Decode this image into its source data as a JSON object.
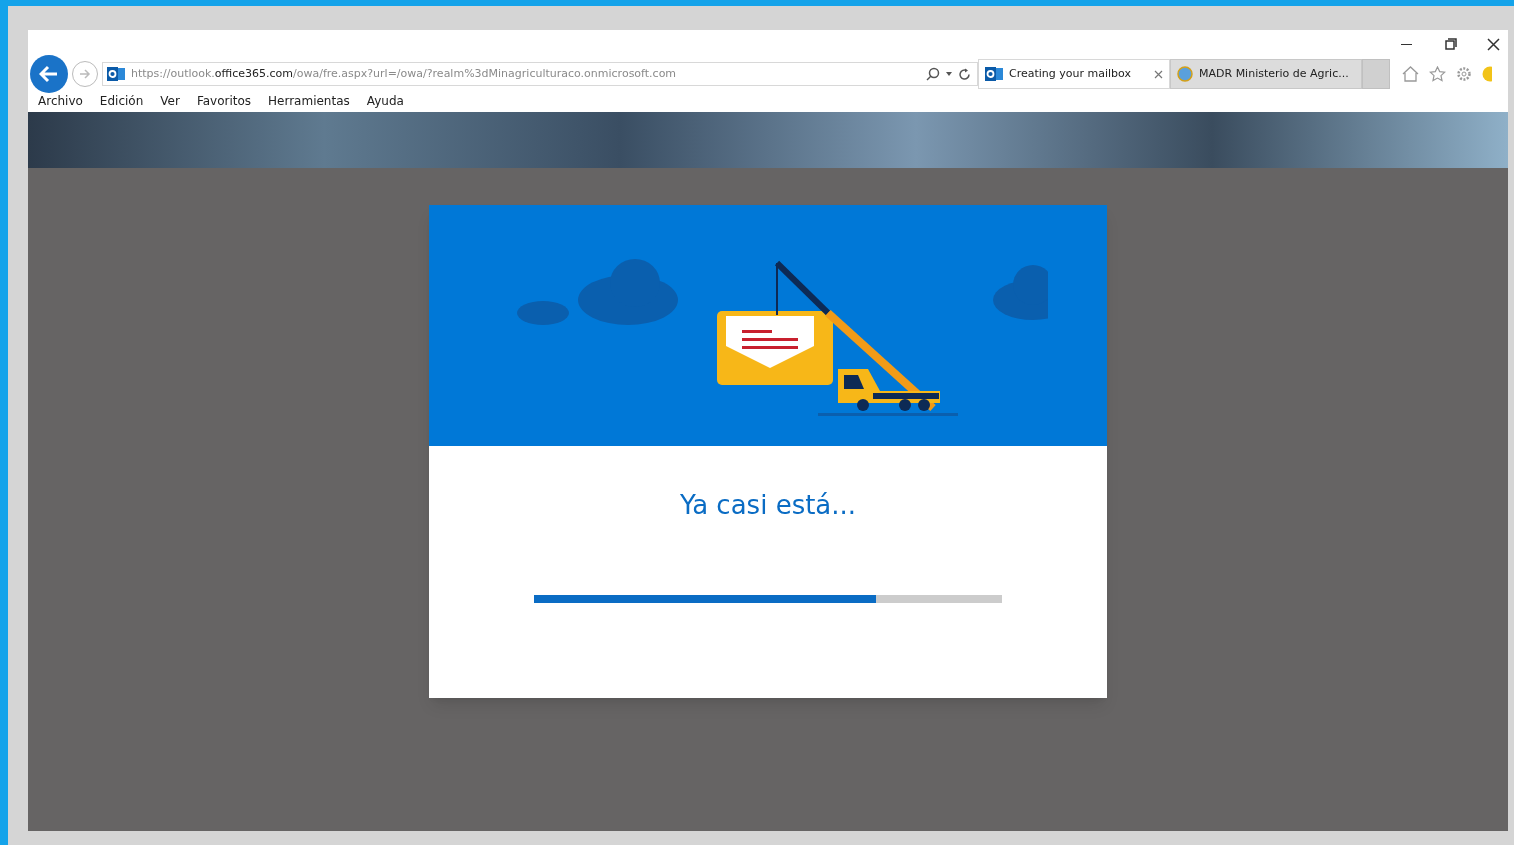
{
  "browser": {
    "address": "https://outlook.**office365.com**/owa/fre.aspx?url=/owa/?realm%3dMinagriculturaco.onmicrosoft.com",
    "tabs": [
      {
        "label": "Creating your mailbox",
        "selected": true,
        "kind": "outlook"
      },
      {
        "label": "MADR Ministerio de Agric...",
        "selected": false,
        "kind": "ie"
      }
    ],
    "menu": [
      "Archivo",
      "Edición",
      "Ver",
      "Favoritos",
      "Herramientas",
      "Ayuda"
    ]
  },
  "dialog": {
    "title": "Ya casi está...",
    "progress": {
      "level": 0.73
    }
  }
}
